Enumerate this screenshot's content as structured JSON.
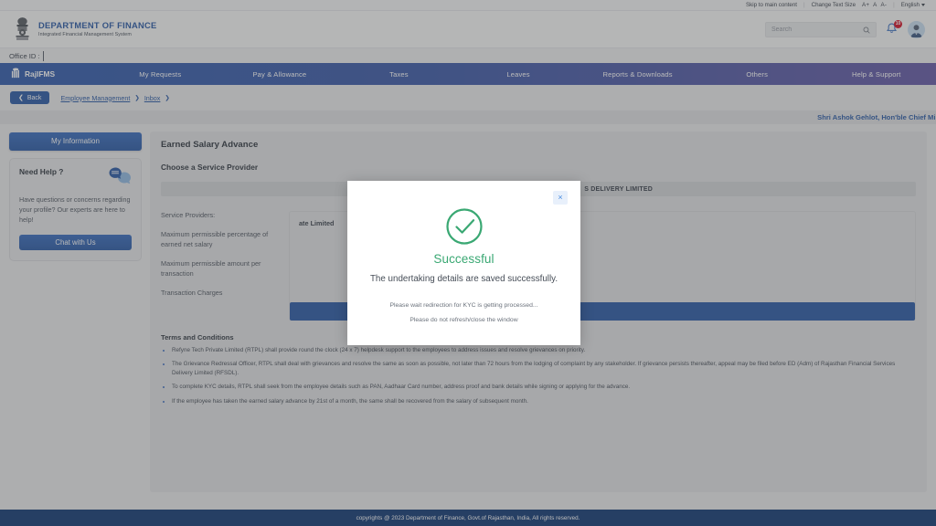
{
  "utility": {
    "skip_link": "Skip to main content",
    "change_text_size": "Change Text Size",
    "size_increase": "A+",
    "size_normal": "A",
    "size_decrease": "A-",
    "language": "English"
  },
  "header": {
    "org_title": "DEPARTMENT OF FINANCE",
    "org_subtitle": "Integrated Financial Management System",
    "search_placeholder": "Search",
    "search_value": "",
    "notification_count": "10"
  },
  "office": {
    "label": "Office ID :",
    "value": ""
  },
  "nav": {
    "brand": "RajIFMS",
    "items": [
      {
        "label": "My Requests"
      },
      {
        "label": "Pay & Allowance"
      },
      {
        "label": "Taxes"
      },
      {
        "label": "Leaves"
      },
      {
        "label": "Reports & Downloads"
      },
      {
        "label": "Others"
      },
      {
        "label": "Help & Support"
      }
    ]
  },
  "breadcrumb": {
    "back_label": "Back",
    "items": [
      "Employee Management",
      "Inbox"
    ],
    "separator": "❯"
  },
  "marquee": {
    "text": "Shri Ashok Gehlot, Hon'ble Chief Minist"
  },
  "sidebar": {
    "my_information": "My Information",
    "help": {
      "title": "Need Help ?",
      "body": "Have questions or concerns regarding your profile? Our experts are here to help!",
      "chat_button": "Chat with Us"
    }
  },
  "main": {
    "page_title": "Earned Salary Advance",
    "section_title": "Choose a Service Provider",
    "provider_bar_text": "S DELIVERY LIMITED",
    "labels": [
      "Service Providers:",
      "Maximum permissible percentage of earned net salary",
      "Maximum permissible amount per transaction",
      "Transaction Charges"
    ],
    "provider_value_name": "ate Limited",
    "terms": {
      "title": "Terms and Conditions",
      "items": [
        "Refyne Tech Private Limited (RTPL) shall provide round the clock (24 x 7) helpdesk support to the employees to address issues and resolve grievances on priority.",
        "The Grievance Redressal Officer, RTPL shall deal with grievances and resolve the same as soon as possible, not later than 72 hours from the lodging of complaint by any stakeholder. If grievance persists thereafter, appeal may be filed before ED (Adm) of Rajasthan Financial Services Delivery Limited (RFSDL).",
        "To complete KYC details, RTPL shall seek from the employee details such as PAN, Aadhaar Card number, address proof and bank details while signing or applying for the advance.",
        "If the employee has taken the earned salary advance by 21st of a month, the same shall be recovered from the salary of subsequent month."
      ]
    }
  },
  "modal": {
    "close_label": "×",
    "title": "Successful",
    "message": "The undertaking details are saved successfully.",
    "note1": "Please wait redirection for KYC is getting processed...",
    "note2": "Please do not refresh/close the window",
    "accent_color": "#3aa873"
  },
  "footer": {
    "text": "copyrights @ 2023 Department of Finance, Govt.of Rajasthan, India, All rights reserved."
  }
}
